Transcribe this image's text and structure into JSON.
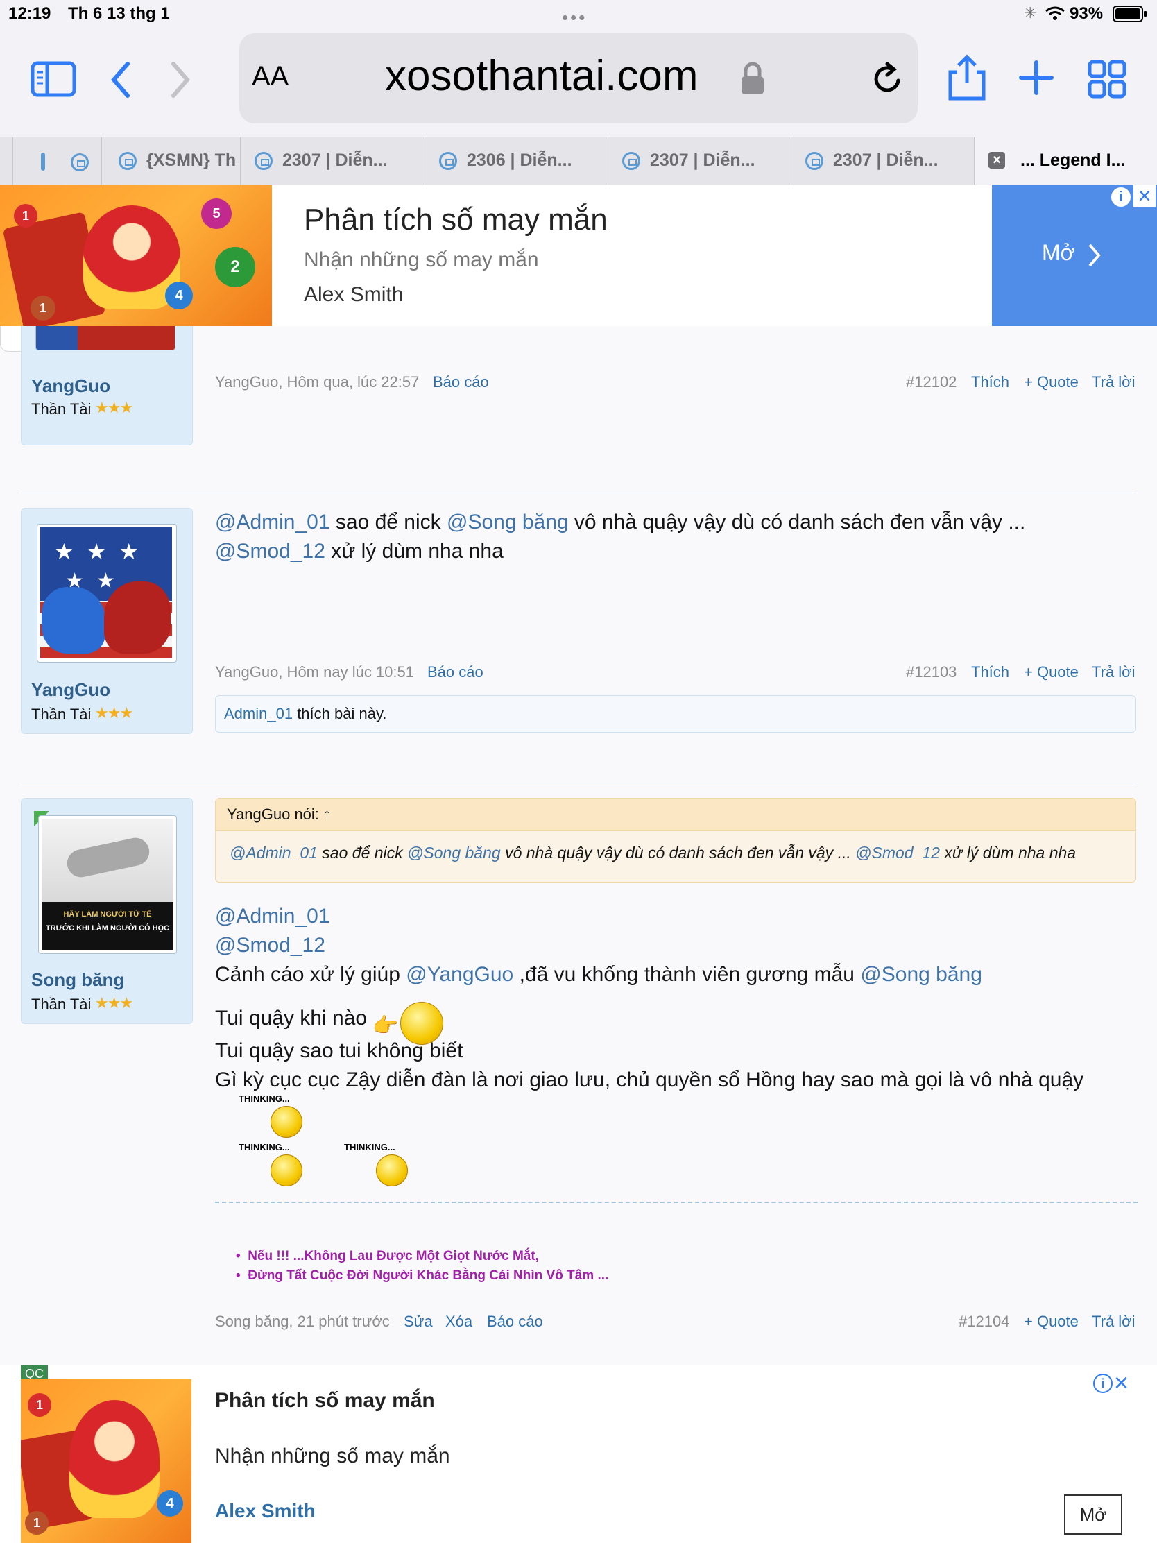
{
  "status_bar": {
    "time": "12:19",
    "date": "Th 6 13 thg 1",
    "battery": "93%"
  },
  "browser": {
    "aa_label": "AA",
    "url": "xosothantai.com"
  },
  "tabs": [
    {
      "label": "{XSMN} Th"
    },
    {
      "label": "2307 | Diễn..."
    },
    {
      "label": "2306 | Diễn..."
    },
    {
      "label": "2307 | Diễn..."
    },
    {
      "label": "2307 | Diễn..."
    },
    {
      "label": "... Legend I..."
    }
  ],
  "banner_ad": {
    "title": "Phân tích số may mắn",
    "subtitle": "Nhận những số may mắn",
    "author": "Alex Smith",
    "cta": "Mở"
  },
  "posts": [
    {
      "username": "YangGuo",
      "user_title": "Thần Tài",
      "stars": "★★★",
      "meta_author": "YangGuo, Hôm qua, lúc 22:57",
      "report": "Báo cáo",
      "post_no": "#12102",
      "like": "Thích",
      "quote": "+ Quote",
      "reply": "Trả lời"
    },
    {
      "username": "YangGuo",
      "user_title": "Thần Tài",
      "stars": "★★★",
      "mention1": "@Admin_01",
      "text1": " sao để nick ",
      "mention2": "@Song băng",
      "text2": " vô nhà quậy vậy dù có danh sách đen vẫn vậy ...",
      "mention3": "@Smod_12",
      "text3": " xử lý dùm nha nha",
      "meta_author": "YangGuo, Hôm nay lúc 10:51",
      "report": "Báo cáo",
      "post_no": "#12103",
      "like": "Thích",
      "quote": "+ Quote",
      "reply": "Trả lời",
      "liked_user": "Admin_01",
      "liked_text": " thích bài này."
    },
    {
      "username": "Song băng",
      "user_title": "Thần Tài",
      "stars": "★★★",
      "avatar_text1": "HÃY LÀM NGƯỜI TỬ TẾ",
      "avatar_text2": "TRƯỚC KHI LÀM NGƯỜI CÓ HỌC",
      "quote_head": "YangGuo nói: ↑",
      "quote_m1": "@Admin_01",
      "quote_t1": " sao để nick ",
      "quote_m2": "@Song băng",
      "quote_t2": " vô nhà quậy vậy dù có danh sách đen vẫn vậy ... ",
      "quote_m3": "@Smod_12",
      "quote_t3": " xử lý dùm nha nha",
      "line1": "@Admin_01",
      "line2": "@Smod_12",
      "line3_a": "Cảnh cáo xử lý giúp ",
      "line3_m1": "@YangGuo",
      "line3_b": " ,đã vu khống thành viên gương mẫu ",
      "line3_m2": "@Song băng",
      "line4": "Tui quậy khi nào",
      "line5": "Tui quậy sao tui không biết",
      "line6": "Gì kỳ cục cục Zậy diễn đàn là nơi giao lưu, chủ quyền sổ Hồng hay sao mà gọi là vô nhà quậy",
      "thinking": "THINKING...",
      "sig1": "Nếu !!! ...Không Lau Được Một Giọt Nước Mắt,",
      "sig2": "Đừng Tất Cuộc Đời Người Khác Bằng Cái Nhìn Vô Tâm ...",
      "meta_author": "Song băng, 21 phút trước",
      "edit": "Sửa",
      "delete": "Xóa",
      "report": "Báo cáo",
      "post_no": "#12104",
      "quote": "+ Quote",
      "reply": "Trả lời"
    }
  ],
  "bottom_ad": {
    "badge": "QC",
    "title": "Phân tích số may mắn",
    "subtitle": "Nhận những số may mắn",
    "author": "Alex Smith",
    "cta": "Mở"
  }
}
